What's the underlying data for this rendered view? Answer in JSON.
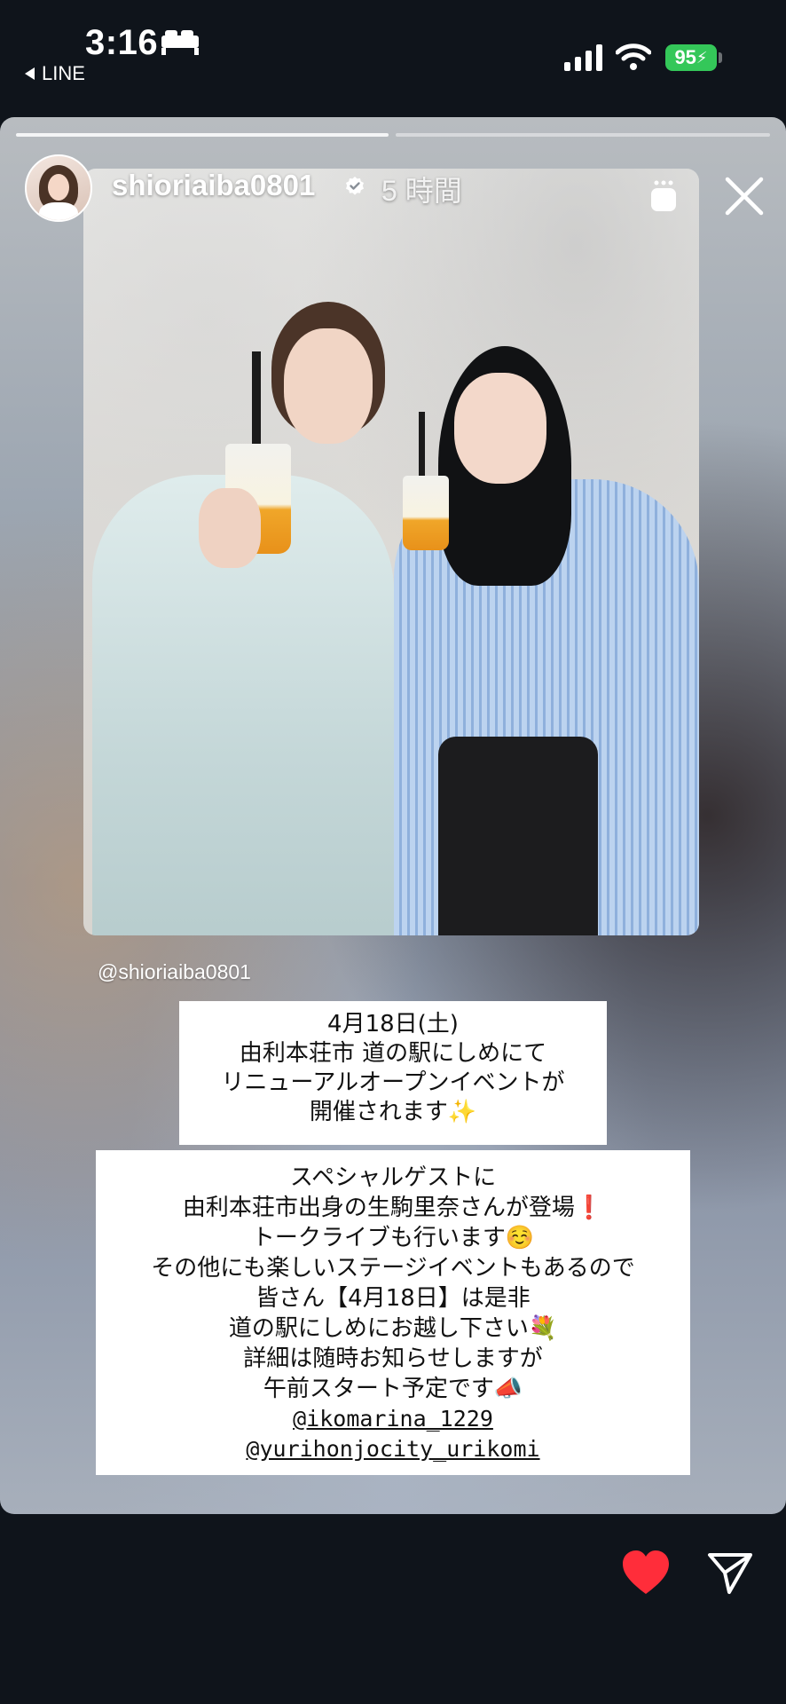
{
  "status_bar": {
    "time": "3:16",
    "back_app": "LINE",
    "battery": "95"
  },
  "story": {
    "username": "shioriaiba0801",
    "time_ago": "5 時間",
    "mention": "@shioriaiba0801",
    "box1_lines": [
      "4月18日(土)",
      "由利本荘市 道の駅にしめにて",
      "リニューアルオープンイベントが",
      "開催されます✨"
    ],
    "box2_lines": [
      "スペシャルゲストに",
      "由利本荘市出身の生駒里奈さんが登場❗️",
      "トークライブも行います☺️",
      "その他にも楽しいステージイベントもあるので",
      "皆さん【4月18日】は是非",
      "道の駅にしめにお越し下さい💐",
      "詳細は随時お知らせしますが",
      "午前スタート予定です📣"
    ],
    "links": [
      "@ikomarina_1229",
      "@yurihonjocity_urikomi"
    ]
  },
  "colors": {
    "background": "#0f141b",
    "battery": "#34c759",
    "heart": "#ff2d3a"
  }
}
